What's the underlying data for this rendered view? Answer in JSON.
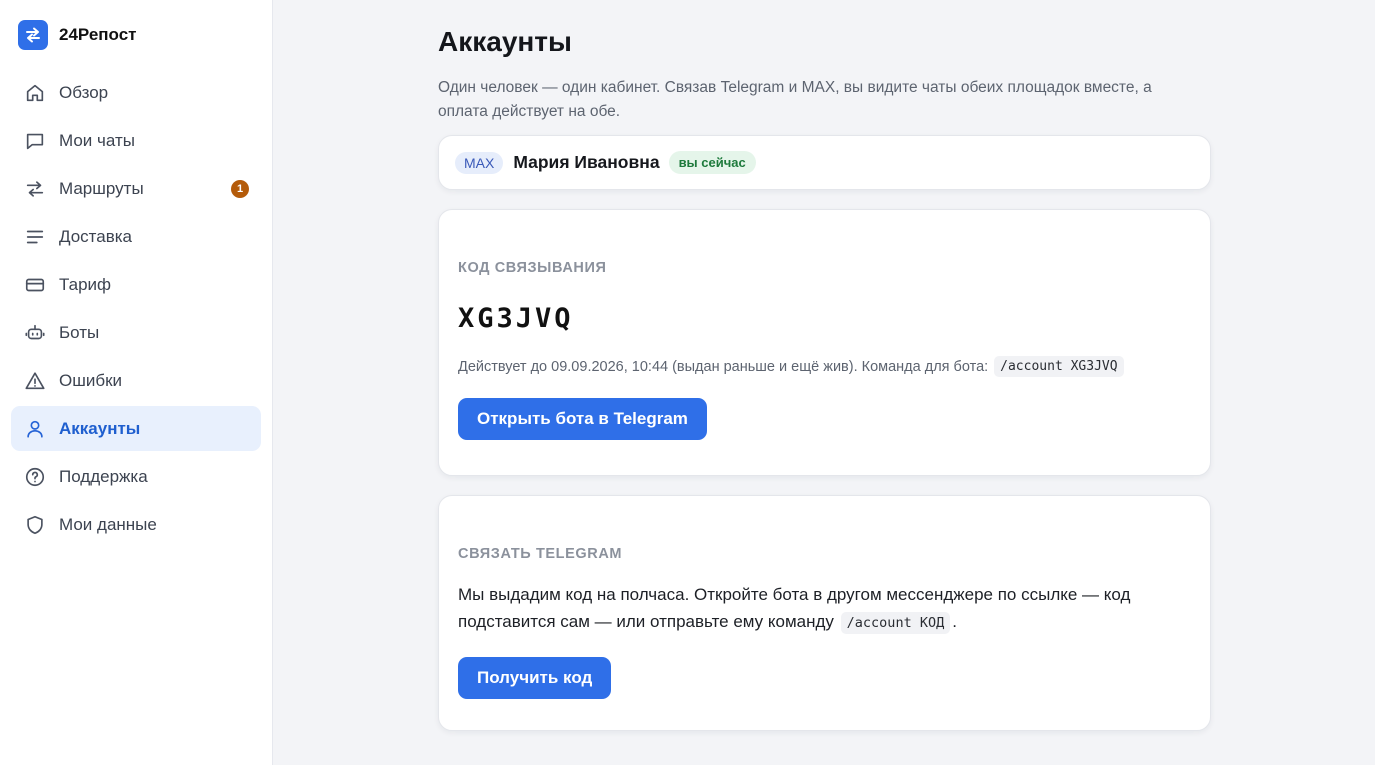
{
  "brand": {
    "name": "24Репост",
    "logo_icon": "swap-arrows-icon",
    "accent": "#2f6fe8"
  },
  "sidebar": {
    "items": [
      {
        "label": "Обзор",
        "icon": "home-icon"
      },
      {
        "label": "Мои чаты",
        "icon": "chat-icon"
      },
      {
        "label": "Маршруты",
        "icon": "routes-icon",
        "badge": "1"
      },
      {
        "label": "Доставка",
        "icon": "lines-icon"
      },
      {
        "label": "Тариф",
        "icon": "card-icon"
      },
      {
        "label": "Боты",
        "icon": "bot-icon"
      },
      {
        "label": "Ошибки",
        "icon": "warning-icon"
      },
      {
        "label": "Аккаунты",
        "icon": "user-icon",
        "active": true
      },
      {
        "label": "Поддержка",
        "icon": "help-icon"
      },
      {
        "label": "Мои данные",
        "icon": "shield-icon"
      }
    ]
  },
  "main": {
    "title": "Аккаунты",
    "description": "Один человек — один кабинет. Связав Telegram и MAX, вы видите чаты обеих площадок вместе, а оплата действует на обе.",
    "account": {
      "platform": "MAX",
      "name": "Мария Ивановна",
      "status": "вы сейчас"
    },
    "link_code": {
      "label": "КОД СВЯЗЫВАНИЯ",
      "code": "XG3JVQ",
      "meta": "Действует до 09.09.2026, 10:44 (выдан раньше и ещё жив). Команда для бота:",
      "command": "/account XG3JVQ",
      "button": "Открыть бота в Telegram"
    },
    "link_telegram": {
      "label": "СВЯЗАТЬ TELEGRAM",
      "text_before": "Мы выдадим код на полчаса. Откройте бота в другом мессенджере по ссылке — код подставится сам — или отправьте ему команду",
      "command": "/account КОД",
      "text_after": ".",
      "button": "Получить код"
    }
  }
}
